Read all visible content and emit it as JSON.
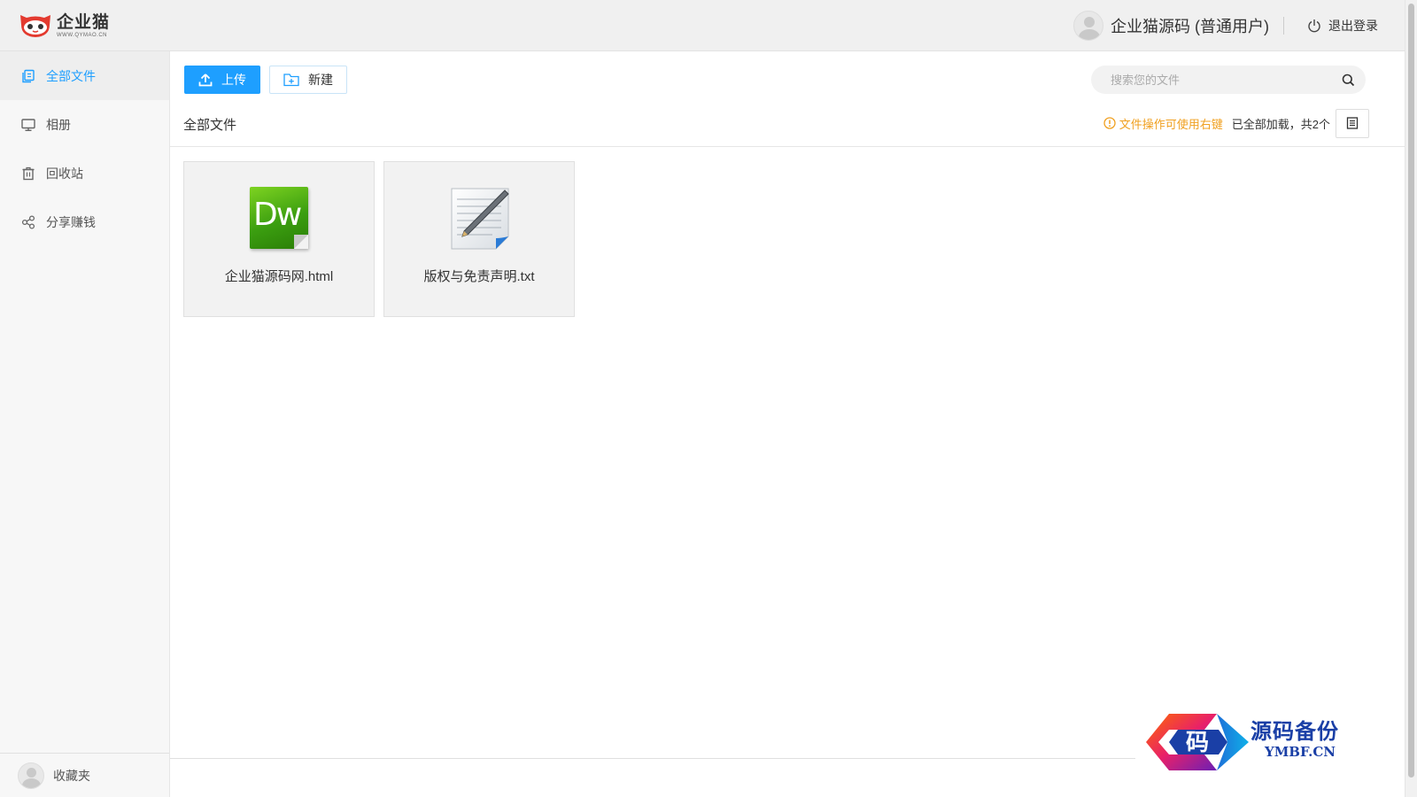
{
  "header": {
    "logo_cn": "企业猫",
    "logo_en": "WWW.QYMAO.CN",
    "username": "企业猫源码 (普通用户)",
    "logout_label": "退出登录"
  },
  "sidebar": {
    "items": [
      {
        "label": "全部文件",
        "icon": "files-icon",
        "active": true
      },
      {
        "label": "相册",
        "icon": "monitor-icon",
        "active": false
      },
      {
        "label": "回收站",
        "icon": "trash-icon",
        "active": false
      },
      {
        "label": "分享赚钱",
        "icon": "share-icon",
        "active": false
      }
    ],
    "bottom_label": "收藏夹"
  },
  "toolbar": {
    "upload_label": "上传",
    "new_label": "新建"
  },
  "search": {
    "placeholder": "搜索您的文件",
    "value": ""
  },
  "path": {
    "title": "全部文件",
    "tip": "文件操作可使用右键",
    "loaded": "已全部加载，共2个"
  },
  "files": [
    {
      "name": "企业猫源码网.html",
      "icon": "dreamweaver-file-icon"
    },
    {
      "name": "版权与免责声明.txt",
      "icon": "text-file-icon"
    }
  ],
  "watermark": {
    "badge": "码",
    "cn": "源码备份",
    "en": "YMBF.CN"
  },
  "colors": {
    "accent": "#1e9fff",
    "tip": "#f0a020",
    "watermark": "#1a3fa6"
  }
}
